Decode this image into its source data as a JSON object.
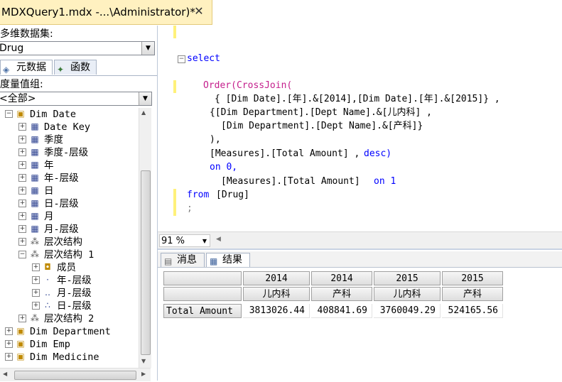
{
  "document_tab": {
    "title": "MDXQuery1.mdx -...\\Administrator)*",
    "close": "✕"
  },
  "left_panel": {
    "cube_label": "多维数据集:",
    "cube_value": "Drug",
    "tabs": [
      {
        "label": "元数据"
      },
      {
        "label": "函数"
      }
    ],
    "measure_group_label": "度量值组:",
    "measure_group_value": "<全部>",
    "tree": [
      {
        "label": "Dim Date",
        "icon": "dimension-icon",
        "expander": "−"
      },
      {
        "label": "Date Key",
        "icon": "attribute-icon",
        "expander": "+"
      },
      {
        "label": "季度",
        "icon": "attribute-icon",
        "expander": "+"
      },
      {
        "label": "季度-层级",
        "icon": "attribute-icon",
        "expander": "+"
      },
      {
        "label": "年",
        "icon": "attribute-icon",
        "expander": "+"
      },
      {
        "label": "年-层级",
        "icon": "attribute-icon",
        "expander": "+"
      },
      {
        "label": "日",
        "icon": "attribute-icon",
        "expander": "+"
      },
      {
        "label": "日-层级",
        "icon": "attribute-icon",
        "expander": "+"
      },
      {
        "label": "月",
        "icon": "attribute-icon",
        "expander": "+"
      },
      {
        "label": "月-层级",
        "icon": "attribute-icon",
        "expander": "+"
      },
      {
        "label": "层次结构",
        "icon": "hierarchy-icon",
        "expander": "+"
      },
      {
        "label": "层次结构 1",
        "icon": "hierarchy-icon",
        "expander": "−"
      },
      {
        "label": "成员",
        "icon": "members-icon",
        "expander": "+"
      },
      {
        "label": "年-层级",
        "icon": "level1-icon",
        "expander": "+"
      },
      {
        "label": "月-层级",
        "icon": "level2-icon",
        "expander": "+"
      },
      {
        "label": "日-层级",
        "icon": "level3-icon",
        "expander": "+"
      },
      {
        "label": "层次结构 2",
        "icon": "hierarchy-icon",
        "expander": "+"
      },
      {
        "label": "Dim Department",
        "icon": "dimension-icon",
        "expander": "+"
      },
      {
        "label": "Dim Emp",
        "icon": "dimension-icon",
        "expander": "+"
      },
      {
        "label": "Dim Medicine",
        "icon": "dimension-icon",
        "expander": "+"
      }
    ]
  },
  "editor": {
    "lines": [
      {
        "t": "select",
        "c": "kw"
      },
      {
        "t": "Order(CrossJoin(",
        "c": "fn"
      },
      {
        "t": "{ [Dim Date].[年].&[2014],[Dim Date].[年].&[2015]} ,",
        "c": "tx"
      },
      {
        "t": "{[Dim Department].[Dept Name].&[儿内科] ,",
        "c": "tx"
      },
      {
        "t": "[Dim Department].[Dept Name].&[产科]}",
        "c": "tx"
      },
      {
        "t": "),",
        "c": "tx"
      },
      {
        "t": "[Measures].[Total Amount] , ",
        "c": "tx"
      },
      {
        "t": "desc)",
        "c": "kw"
      },
      {
        "t": "on 0,",
        "c": "kw"
      },
      {
        "t": "[Measures].[Total Amount]   ",
        "c": "tx"
      },
      {
        "t": "on 1",
        "c": "kw"
      },
      {
        "t": "from ",
        "c": "kw"
      },
      {
        "t": "[Drug]",
        "c": "tx"
      },
      {
        "t": ";",
        "c": "gy"
      }
    ]
  },
  "zoom": {
    "value": "91 %"
  },
  "results": {
    "tabs": [
      {
        "label": "消息"
      },
      {
        "label": "结果"
      }
    ],
    "col_headers_row1": [
      "2014",
      "2014",
      "2015",
      "2015"
    ],
    "col_headers_row2": [
      "儿内科",
      "产科",
      "儿内科",
      "产科"
    ],
    "row_label": "Total Amount",
    "values": [
      "3813026.44",
      "408841.69",
      "3760049.29",
      "524165.56"
    ]
  },
  "colors": {
    "tab_active": "#fff1c0",
    "keyword": "#0000ff",
    "function": "#c41e8c"
  }
}
